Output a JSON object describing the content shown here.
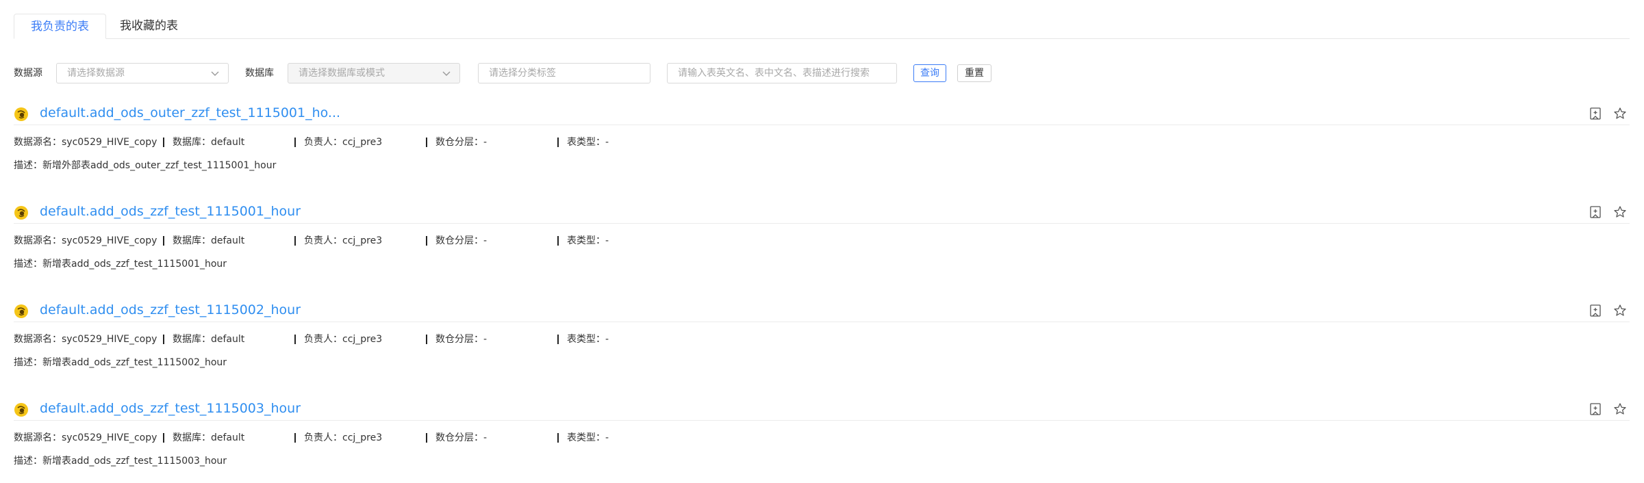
{
  "tabs": [
    {
      "label": "我负责的表",
      "active": true
    },
    {
      "label": "我收藏的表",
      "active": false
    }
  ],
  "filters": {
    "datasource_label": "数据源",
    "datasource_placeholder": "请选择数据源",
    "database_label": "数据库",
    "database_placeholder": "请选择数据库或模式",
    "tag_placeholder": "请选择分类标签",
    "search_placeholder": "请输入表英文名、表中文名、表描述进行搜索",
    "query_label": "查询",
    "reset_label": "重置"
  },
  "records": [
    {
      "title": "default.add_ods_outer_zzf_test_1115001_ho...",
      "meta": {
        "datasource": "数据源名：syc0529_HIVE_copy",
        "database": "数据库：default",
        "owner": "负责人：ccj_pre3",
        "layer": "数仓分层：-",
        "type": "表类型：-"
      },
      "description": "描述：新增外部表add_ods_outer_zzf_test_1115001_hour"
    },
    {
      "title": "default.add_ods_zzf_test_1115001_hour",
      "meta": {
        "datasource": "数据源名：syc0529_HIVE_copy",
        "database": "数据库：default",
        "owner": "负责人：ccj_pre3",
        "layer": "数仓分层：-",
        "type": "表类型：-"
      },
      "description": "描述：新增表add_ods_zzf_test_1115001_hour"
    },
    {
      "title": "default.add_ods_zzf_test_1115002_hour",
      "meta": {
        "datasource": "数据源名：syc0529_HIVE_copy",
        "database": "数据库：default",
        "owner": "负责人：ccj_pre3",
        "layer": "数仓分层：-",
        "type": "表类型：-"
      },
      "description": "描述：新增表add_ods_zzf_test_1115002_hour"
    },
    {
      "title": "default.add_ods_zzf_test_1115003_hour",
      "meta": {
        "datasource": "数据源名：syc0529_HIVE_copy",
        "database": "数据库：default",
        "owner": "负责人：ccj_pre3",
        "layer": "数仓分层：-",
        "type": "表类型：-"
      },
      "description": "描述：新增表add_ods_zzf_test_1115003_hour"
    }
  ],
  "icons": {
    "table": "table-type-icon",
    "bookmark": "bookmark-icon",
    "favorite": "star-icon",
    "dropdown": "chevron-down-icon"
  },
  "colors": {
    "accent": "#3b7cf6",
    "link": "#2f8ef0",
    "icon_yellow": "#f5c518"
  }
}
